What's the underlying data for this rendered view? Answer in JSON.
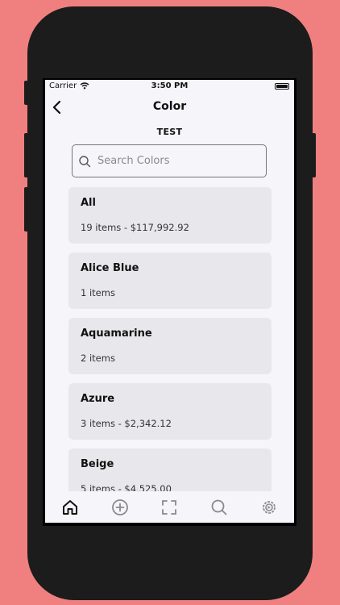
{
  "status": {
    "carrier": "Carrier",
    "time": "3:50 PM"
  },
  "nav": {
    "title": "Color",
    "back_icon": "chevron-left-icon"
  },
  "subtitle": "TEST",
  "search": {
    "placeholder": "Search Colors",
    "value": ""
  },
  "items": [
    {
      "name": "All",
      "detail": "19 items - $117,992.92"
    },
    {
      "name": "Alice Blue",
      "detail": "1 items"
    },
    {
      "name": "Aquamarine",
      "detail": "2 items"
    },
    {
      "name": "Azure",
      "detail": "3 items - $2,342.12"
    },
    {
      "name": "Beige",
      "detail": "5 items - $4,525.00"
    }
  ],
  "tabs": [
    {
      "icon": "home-icon",
      "active": true
    },
    {
      "icon": "plus-circle-icon",
      "active": false
    },
    {
      "icon": "scan-icon",
      "active": false
    },
    {
      "icon": "search-icon",
      "active": false
    },
    {
      "icon": "settings-icon",
      "active": false
    }
  ],
  "colors": {
    "background": "#f08080",
    "phone": "#1c1c1c",
    "screen": "#f5f5fa",
    "card": "#e8e8ec",
    "tab_inactive": "#8a8a8e"
  }
}
